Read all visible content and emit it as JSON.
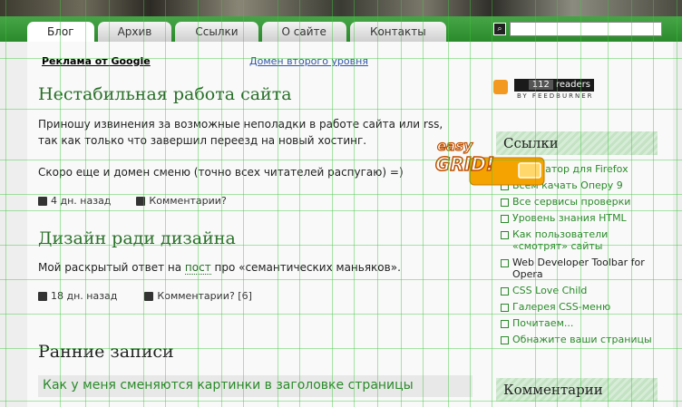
{
  "nav": {
    "tabs": [
      {
        "label": "Блог",
        "active": true
      },
      {
        "label": "Архив",
        "active": false
      },
      {
        "label": "Ссылки",
        "active": false
      },
      {
        "label": "О сайте",
        "active": false
      },
      {
        "label": "Контакты",
        "active": false
      }
    ],
    "search_placeholder": ""
  },
  "ads": {
    "google": "Реклама от Google",
    "domain": "Домен второго уровня"
  },
  "posts": [
    {
      "title": "Нестабильная работа сайта",
      "para1": "Приношу извинения за возможные неполадки в работе сайта или rss,",
      "para2": "так как только что завершил переезд на новый хостинг.",
      "para3": "Скоро еще и домен сменю (точно всех читателей распугаю) =)",
      "date": "4 дн. назад",
      "comments": "Комментарии?"
    },
    {
      "title": "Дизайн ради дизайна",
      "text_before": "Мой раскрытый ответ на ",
      "link": "пост",
      "text_after": " про «семантических маньяков».",
      "date": "18 дн. назад",
      "comments": "Комментарии? [6]"
    }
  ],
  "recent": {
    "title": "Ранние записи",
    "first": "Как у меня сменяются картинки в заголовке страницы"
  },
  "sidebar": {
    "readers_count": "112",
    "readers_label": "readers",
    "feedburner": "BY FEEDBURNER",
    "links_title": "Ссылки",
    "links": [
      "Валидатор для Firefox",
      "Всем качать Оперу 9",
      "Все сервисы проверки",
      "Уровень знания HTML",
      "Как пользователи «смотрят» сайты",
      "Web Developer Toolbar for Opera",
      "CSS Love Child",
      "Галерея CSS-меню",
      "Почитаем...",
      "Обнажите ваши страницы"
    ],
    "comments_title": "Комментарии"
  },
  "easygrid": {
    "top": "easy",
    "bottom": "GRID!"
  },
  "colors": {
    "accent": "#2b8a2b",
    "link": "#2a8a2a",
    "title": "#2a6e2a"
  }
}
